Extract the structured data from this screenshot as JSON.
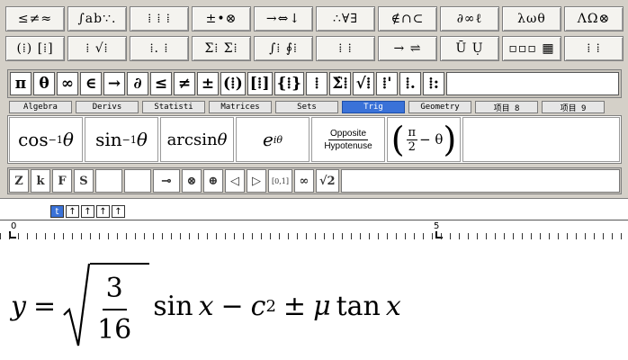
{
  "palette": {
    "row1": [
      "≤≠≈",
      "∫ab∵.",
      "⁞ ⁞ ⁞",
      "±•⊗",
      "→⇔↓",
      "∴∀∃",
      "∉∩⊂",
      "∂∞ℓ",
      "λωθ",
      "ΛΩ⊗"
    ],
    "row2": [
      "(⁞) [⁞]",
      "⁞ √⁞",
      "⁞. ⁞",
      "Σ⁞ Σ⁞",
      "∫⁞ ∮⁞",
      "⁞ ⁞",
      "→ ⇌",
      "Ū Ụ",
      "▫▫▫ ▦",
      "⁞ ⁞"
    ]
  },
  "symbols": [
    "π",
    "θ",
    "∞",
    "∈",
    "→",
    "∂",
    "≤",
    "≠",
    "±",
    "(⁞)",
    "[⁞]",
    "{⁞}",
    "⁞",
    "Σ̇⁞",
    "√⁞",
    "⁞'",
    "⁞.",
    "⁞:"
  ],
  "tabs": [
    "Algebra",
    "Derivs",
    "Statisti",
    "Matrices",
    "Sets",
    "Trig",
    "Geometry",
    "项目 8",
    "项目 9"
  ],
  "active_tab": "Trig",
  "templates": {
    "arccos_base": "cos",
    "arccos_exp": "−1",
    "arccos_var": "θ",
    "arcsin_base": "sin",
    "arcsin_exp": "−1",
    "arcsin_var": "θ",
    "arcsin_word": "arcsin",
    "arcsin_word_var": "θ",
    "euler_base": "e",
    "euler_exp": "iθ",
    "ratio_num": "Opposite",
    "ratio_den": "Hypotenuse",
    "shift_num": "π",
    "shift_den": "2",
    "shift_rest": "− θ"
  },
  "small_buttons": [
    "Z",
    "k",
    "F",
    "S",
    "",
    "",
    "⊸",
    "⊗",
    "⊕",
    "◁",
    "▷",
    "[0,1]",
    "∞",
    "√2"
  ],
  "size_buttons": [
    "t",
    "↑",
    "↑",
    "↑",
    "↑"
  ],
  "ruler": {
    "mark_0": "0",
    "mark_5": "5"
  },
  "equation": {
    "lhs": "y",
    "equals": "=",
    "frac_num": "3",
    "frac_den": "16",
    "sin": "sin",
    "x1": "x",
    "minus": "−",
    "c": "c",
    "c_exp": "2",
    "pm": "±",
    "mu": "μ",
    "tan": "tan",
    "x2": "x"
  }
}
